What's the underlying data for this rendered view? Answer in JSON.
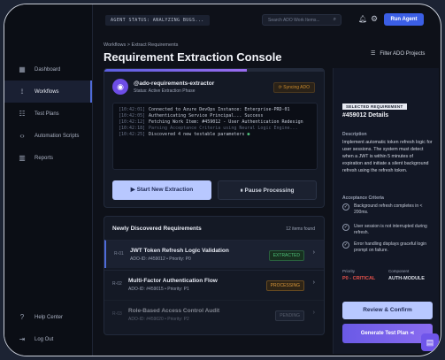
{
  "sidebar": {
    "items": [
      {
        "label": "Dashboard",
        "icon": "dashboard-icon"
      },
      {
        "label": "Workflows",
        "icon": "workflow-icon"
      },
      {
        "label": "Test Plans",
        "icon": "clipboard-icon"
      },
      {
        "label": "Automation Scripts",
        "icon": "code-icon"
      },
      {
        "label": "Reports",
        "icon": "chart-icon"
      }
    ],
    "bottom": [
      {
        "label": "Help Center",
        "icon": "help-icon"
      },
      {
        "label": "Log Out",
        "icon": "logout-icon"
      }
    ]
  },
  "topbar": {
    "status": "AGENT STATUS: ANALYZING BUGS...",
    "search_placeholder": "Search ADO Work Items...",
    "run_agent": "Run Agent"
  },
  "header": {
    "breadcrumb": "Workflows > Extract Requirements",
    "title": "Requirement Extraction Console",
    "filter": "Filter ADO Projects"
  },
  "extraction": {
    "progress": 0.65,
    "agent_name": "@ado-requirements-extractor",
    "agent_status": "Status: Active Extraction Phase",
    "sync_badge": "Syncing ADO",
    "logs": [
      {
        "ts": "[10:42:01]",
        "msg": "Connected to Azure DevOps Instance: Enterprise-PRD-01",
        "dim": false
      },
      {
        "ts": "[10:42:05]",
        "msg": "Authenticating Service Principal... Success",
        "dim": false
      },
      {
        "ts": "[10:42:12]",
        "msg": "Fetching Work Item: #459012 - User Authentication Redesign",
        "dim": false
      },
      {
        "ts": "[10:42:18]",
        "msg": "Parsing Acceptance Criteria using Neural Logic Engine...",
        "dim": true
      },
      {
        "ts": "[10:42:25]",
        "msg": "Discovered 4 new testable parameters",
        "dim": false
      }
    ],
    "start_button": "Start New Extraction",
    "pause_button": "Pause Processing"
  },
  "requirements": {
    "title": "Newly Discovered Requirements",
    "count": "12 items found",
    "rows": [
      {
        "id": "R-01",
        "title": "JWT Token Refresh Logic Validation",
        "meta": "ADO-ID: #459012 • Priority: P0",
        "status": "EXTRACTED",
        "status_color": "#4ec07a",
        "status_bg": "#17301f"
      },
      {
        "id": "R-02",
        "title": "Multi-Factor Authentication Flow",
        "meta": "ADO-ID: #459015 • Priority: P1",
        "status": "PROCESSING",
        "status_color": "#d9973a",
        "status_bg": "#2e2416"
      },
      {
        "id": "R-03",
        "title": "Role-Based Access Control Audit",
        "meta": "ADO-ID: #459020 • Priority: P2",
        "status": "PENDING",
        "status_color": "#9aa2b4",
        "status_bg": "#222a3b"
      }
    ]
  },
  "details": {
    "tag": "SELECTED REQUIREMENT",
    "id": "#459012 Details",
    "description_label": "Description",
    "description": "Implement automatic token refresh logic for user sessions. The system must detect when a JWT is within 5 minutes of expiration and initiate a silent background refresh using the refresh token.",
    "criteria_label": "Acceptance Criteria",
    "criteria": [
      "Background refresh completes in < 200ms.",
      "User session is not interrupted during refresh.",
      "Error handling displays graceful login prompt on failure."
    ],
    "priority_label": "Priority",
    "priority": "P0 - CRITICAL",
    "component_label": "Component",
    "component": "AUTH-MODULE",
    "review_button": "Review & Confirm",
    "generate_button": "Generate Test Plan"
  },
  "colors": {
    "accent": "#3b5fe6",
    "primary_light": "#b8c8ff",
    "critical": "#e4514a"
  }
}
